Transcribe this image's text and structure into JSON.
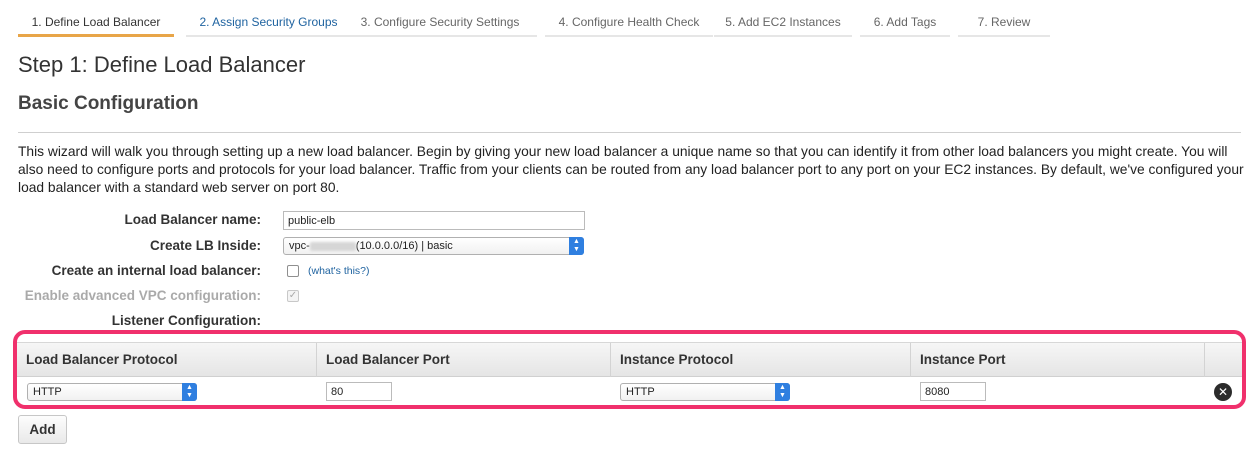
{
  "wizard": {
    "steps": [
      {
        "label": "1. Define Load Balancer"
      },
      {
        "label": "2. Assign Security Groups"
      },
      {
        "label": "3. Configure Security Settings"
      },
      {
        "label": "4. Configure Health Check"
      },
      {
        "label": "5. Add EC2 Instances"
      },
      {
        "label": "6. Add Tags"
      },
      {
        "label": "7. Review"
      }
    ],
    "active_step": 1
  },
  "page": {
    "title": "Step 1: Define Load Balancer",
    "section_title": "Basic Configuration",
    "description": "This wizard will walk you through setting up a new load balancer. Begin by giving your new load balancer a unique name so that you can identify it from other load balancers you might create. You will also need to configure ports and protocols for your load balancer. Traffic from your clients can be routed from any load balancer port to any port on your EC2 instances. By default, we've configured your load balancer with a standard web server on port 80."
  },
  "form": {
    "name_label": "Load Balancer name:",
    "name_value": "public-elb",
    "vpc_label": "Create LB Inside:",
    "vpc_prefix": "vpc-",
    "vpc_suffix": "(10.0.0.0/16) | basic",
    "internal_label": "Create an internal load balancer:",
    "internal_checked": false,
    "whats_this": "(what's this?)",
    "advanced_label": "Enable advanced VPC configuration:",
    "advanced_checked": true,
    "listener_label": "Listener Configuration:"
  },
  "listeners": {
    "headers": [
      "Load Balancer Protocol",
      "Load Balancer Port",
      "Instance Protocol",
      "Instance Port"
    ],
    "rows": [
      {
        "lb_protocol": "HTTP",
        "lb_port": "80",
        "instance_protocol": "HTTP",
        "instance_port": "8080"
      }
    ],
    "highlight_color": "#f0306c"
  },
  "actions": {
    "add_label": "Add"
  },
  "colors": {
    "active_tab_underline": "#e8a548",
    "link": "#1f63a0",
    "select_arrow": "#2f7fe0"
  }
}
